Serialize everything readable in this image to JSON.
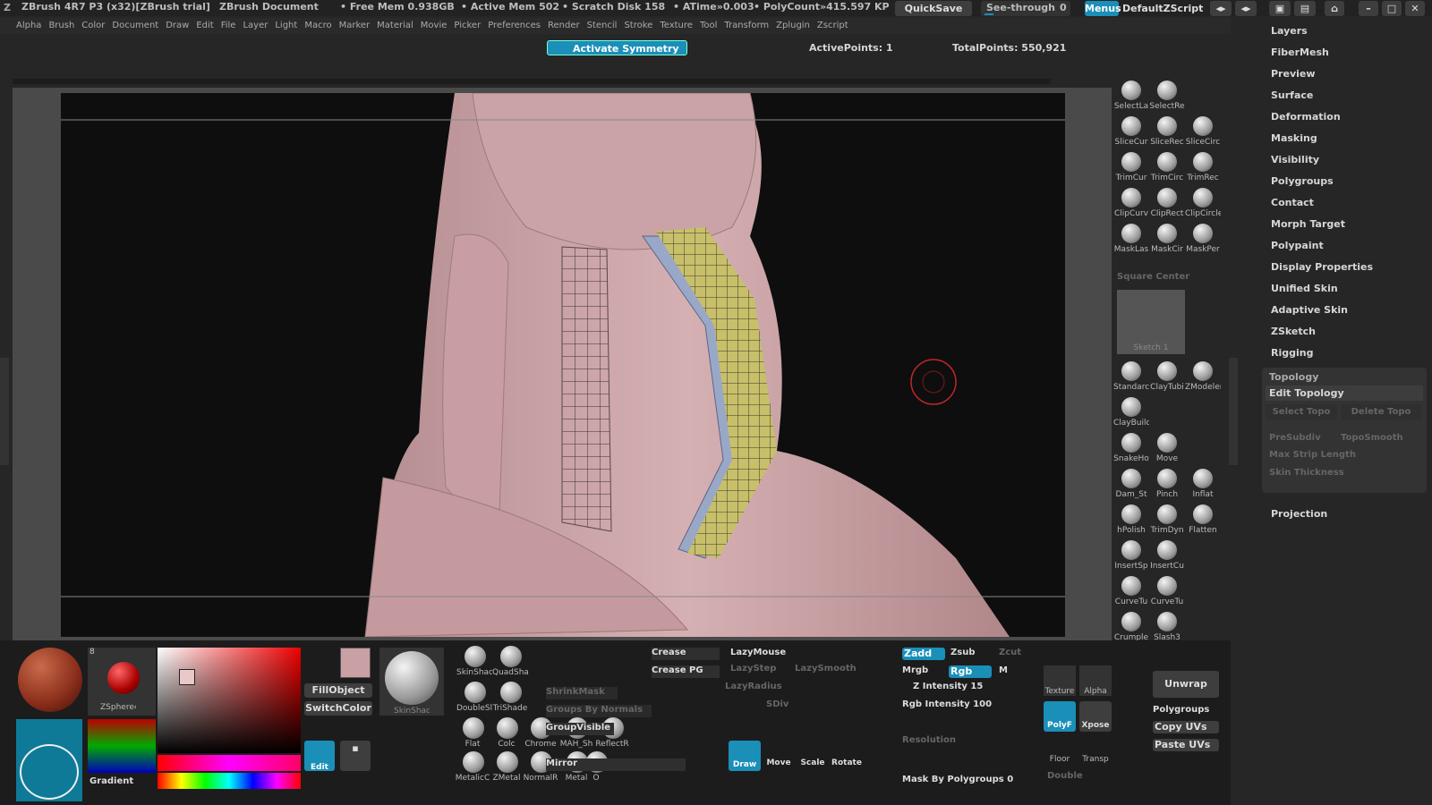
{
  "title": {
    "app": "ZBrush 4R7 P3 (x32)[ZBrush trial]",
    "doc": "ZBrush Document",
    "free_mem": "• Free Mem 0.938GB",
    "active_mem": "• Active Mem 502",
    "scratch": "• Scratch Disk 158",
    "atime": "• ATime»0.003",
    "polycount": "• PolyCount»415.597 KP",
    "quicksave": "QuickSave",
    "seethrough": "See-through",
    "seethrough_val": "0",
    "menus": "Menus",
    "zscript": "DefaultZScript"
  },
  "menu": [
    "Alpha",
    "Brush",
    "Color",
    "Document",
    "Draw",
    "Edit",
    "File",
    "Layer",
    "Light",
    "Macro",
    "Marker",
    "Material",
    "Movie",
    "Picker",
    "Preferences",
    "Render",
    "Stencil",
    "Stroke",
    "Texture",
    "Tool",
    "Transform",
    "Zplugin",
    "Zscript"
  ],
  "status": {
    "symmetry": "Activate Symmetry",
    "active_points": "ActivePoints: 1",
    "total_points": "TotalPoints: 550,921"
  },
  "right_menu": [
    "Layers",
    "FiberMesh",
    "Preview",
    "Surface",
    "Deformation",
    "Masking",
    "Visibility",
    "Polygroups",
    "Contact",
    "Morph Target",
    "Polypaint",
    "Display Properties",
    "Unified Skin",
    "Adaptive Skin",
    "ZSketch",
    "Rigging"
  ],
  "topology": {
    "title": "Topology",
    "edit": "Edit Topology",
    "select": "Select Topo",
    "delete": "Delete Topo",
    "presubdiv": "PreSubdiv",
    "toposmooth": "TopoSmooth",
    "maxstrip": "Max Strip Length",
    "skin": "Skin Thickness",
    "projection": "Projection"
  },
  "tools": {
    "row1": [
      "SelectLa",
      "SelectRe"
    ],
    "row2": [
      "SliceCur",
      "SliceRec",
      "SliceCirc"
    ],
    "row3": [
      "TrimCur",
      "TrimCirc",
      "TrimRec"
    ],
    "row4": [
      "ClipCurv",
      "ClipRect",
      "ClipCircle"
    ],
    "row5": [
      "MaskLas",
      "MaskCir",
      "MaskPer"
    ],
    "square_center": "Square Center",
    "sketch": "Sketch 1"
  },
  "brushes": [
    [
      "Standarc",
      "ClayTubi",
      "ZModeler"
    ],
    [
      "ClayBuild"
    ],
    [
      "SnakeHo",
      "Move"
    ],
    [
      "Dam_St",
      "Pinch",
      "Inflat"
    ],
    [
      "hPolish",
      "TrimDyn",
      "Flatten"
    ],
    [
      "InsertSp",
      "InsertCu"
    ],
    [
      "CurveTu",
      "CurveTu"
    ],
    [
      "Crumple",
      "Slash3"
    ]
  ],
  "bottom": {
    "zsphere": "ZSphere4",
    "zsphere_num": "8",
    "gradient": "Gradient",
    "fillobject": "FillObject",
    "switchcolor": "SwitchColor",
    "edit": "Edit",
    "skinshade": "SkinShade4",
    "materials": [
      "SkinShac",
      "QuadSha",
      "DoubleSl",
      "TriShade",
      "Flat",
      "Colc",
      "Chrome",
      "MAH_Sh",
      "ReflectR",
      "MetalicC",
      "ZMetal",
      "NormalR",
      "Metal",
      "O"
    ],
    "shrinkmask": "ShrinkMask",
    "groups_normals": "Groups By Normals",
    "groupvisible": "GroupVisible",
    "mirror": "Mirror",
    "crease": "Crease",
    "crease_pg": "Crease PG",
    "lazymouse": "LazyMouse",
    "lazystep": "LazyStep",
    "lazysmooth": "LazySmooth",
    "lazyradius": "LazyRadius",
    "sdiv": "SDiv",
    "draw": "Draw",
    "move": "Move",
    "scale": "Scale",
    "rotate": "Rotate",
    "zadd": "Zadd",
    "zsub": "Zsub",
    "zcut": "Zcut",
    "mrgb": "Mrgb",
    "rgb": "Rgb",
    "m": "M",
    "z_intensity": "Z Intensity 15",
    "rgb_intensity": "Rgb Intensity 100",
    "resolution": "Resolution",
    "mask_pg": "Mask By Polygroups 0",
    "double": "Double",
    "texture": "Texture",
    "alpha": "Alpha",
    "polyf": "PolyF",
    "xpose": "Xpose",
    "floor": "Floor",
    "transp": "Transp",
    "unwrap": "Unwrap",
    "polygroups": "Polygroups",
    "copy_uvs": "Copy UVs",
    "paste_uvs": "Paste UVs"
  },
  "colors": {
    "accent": "#1a8fb8",
    "bg": "#262626",
    "skin": "#c9a1a4",
    "mesh_yellow": "#c8bf6a",
    "mesh_blue": "#9aa8c8"
  }
}
